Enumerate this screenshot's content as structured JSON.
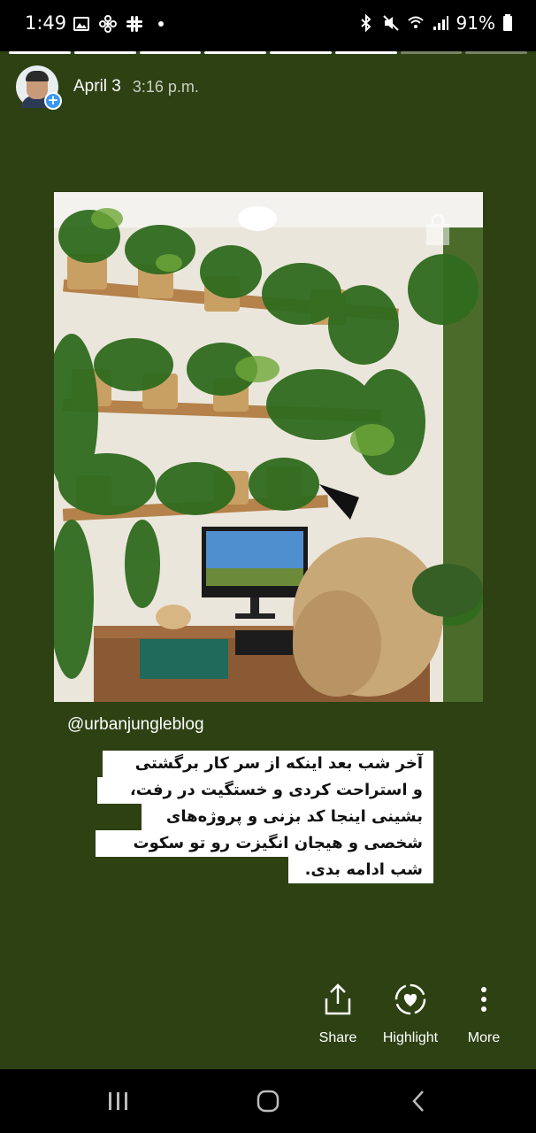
{
  "status_bar": {
    "time": "1:49",
    "battery": "91%",
    "left_icons": [
      "image-icon",
      "pinwheel-icon",
      "slack-icon",
      "dot-icon"
    ],
    "right_icons": [
      "bluetooth-icon",
      "mute-icon",
      "wifi-icon",
      "signal-icon",
      "battery-icon"
    ]
  },
  "story": {
    "segments_total": 8,
    "segments_done": 6,
    "date": "April 3",
    "time": "3:16 p.m.",
    "avatar_badge": "+"
  },
  "post": {
    "handle": "@urbanjungleblog",
    "caption_lines": [
      "آخر شب بعد اینکه از سر کار برگشتی",
      "و استراحت کردی و خستگیت در رفت،",
      "بشینی اینجا کد بزنی و پروژه‌های",
      "شخصی و هیجان انگیزت رو تو سکوت",
      "شب ادامه بدی."
    ]
  },
  "actions": {
    "share": "Share",
    "highlight": "Highlight",
    "more": "More"
  },
  "colors": {
    "background": "#2d4113",
    "accent": "#3897f0"
  }
}
